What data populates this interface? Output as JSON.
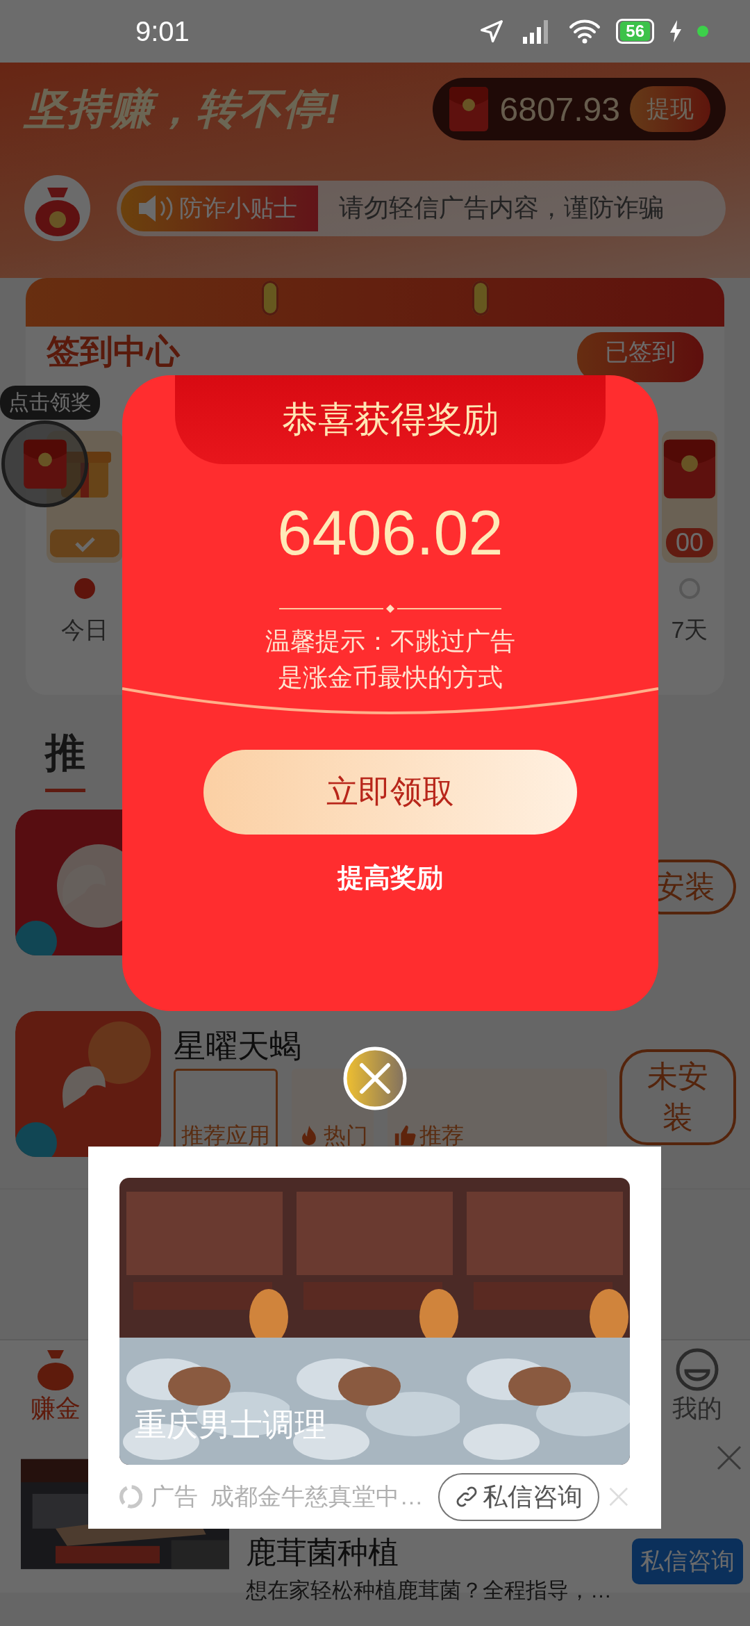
{
  "status_bar": {
    "time": "9:01",
    "battery": "56"
  },
  "header": {
    "slogan": "坚持赚，转不停!",
    "balance": "6807.93",
    "withdraw_button": "提现"
  },
  "notice": {
    "tag": "防诈小贴士",
    "text": "请勿轻信广告内容，谨防诈骗"
  },
  "checkin": {
    "title": "签到中心",
    "status_button": "已签到",
    "days": [
      {
        "label": "今日",
        "checked": true
      },
      {
        "label": "7天",
        "checked": false,
        "reward": "00"
      }
    ]
  },
  "float_reward": {
    "tooltip": "点击领奖"
  },
  "section_title": "推",
  "apps": [
    {
      "button": "安装"
    },
    {
      "name": "星曜天蝎",
      "tags": [
        {
          "label": "推荐应用",
          "kind": "outline"
        },
        {
          "label": "热门",
          "kind": "hot"
        },
        {
          "label": "推荐",
          "kind": "thumb"
        }
      ],
      "button": "未安装"
    }
  ],
  "nav": [
    {
      "label": "赚金",
      "selected": true
    },
    {
      "label": "我的",
      "selected": false
    }
  ],
  "banner_ad": {
    "title": "鹿茸菌种植",
    "description": "想在家轻松种植鹿茸菌？全程指导，…",
    "button": "私信咨询"
  },
  "reward_dialog": {
    "title": "恭喜获得奖励",
    "amount": "6406.02",
    "tip": [
      "温馨提示：不跳过广告",
      "是涨金币最快的方式"
    ],
    "claim_button": "立即领取",
    "boost_link": "提高奖励"
  },
  "ad": {
    "caption": "重庆男士调理",
    "label": "广告",
    "advertiser": "成都金牛慈真堂中…",
    "button": "私信咨询"
  }
}
